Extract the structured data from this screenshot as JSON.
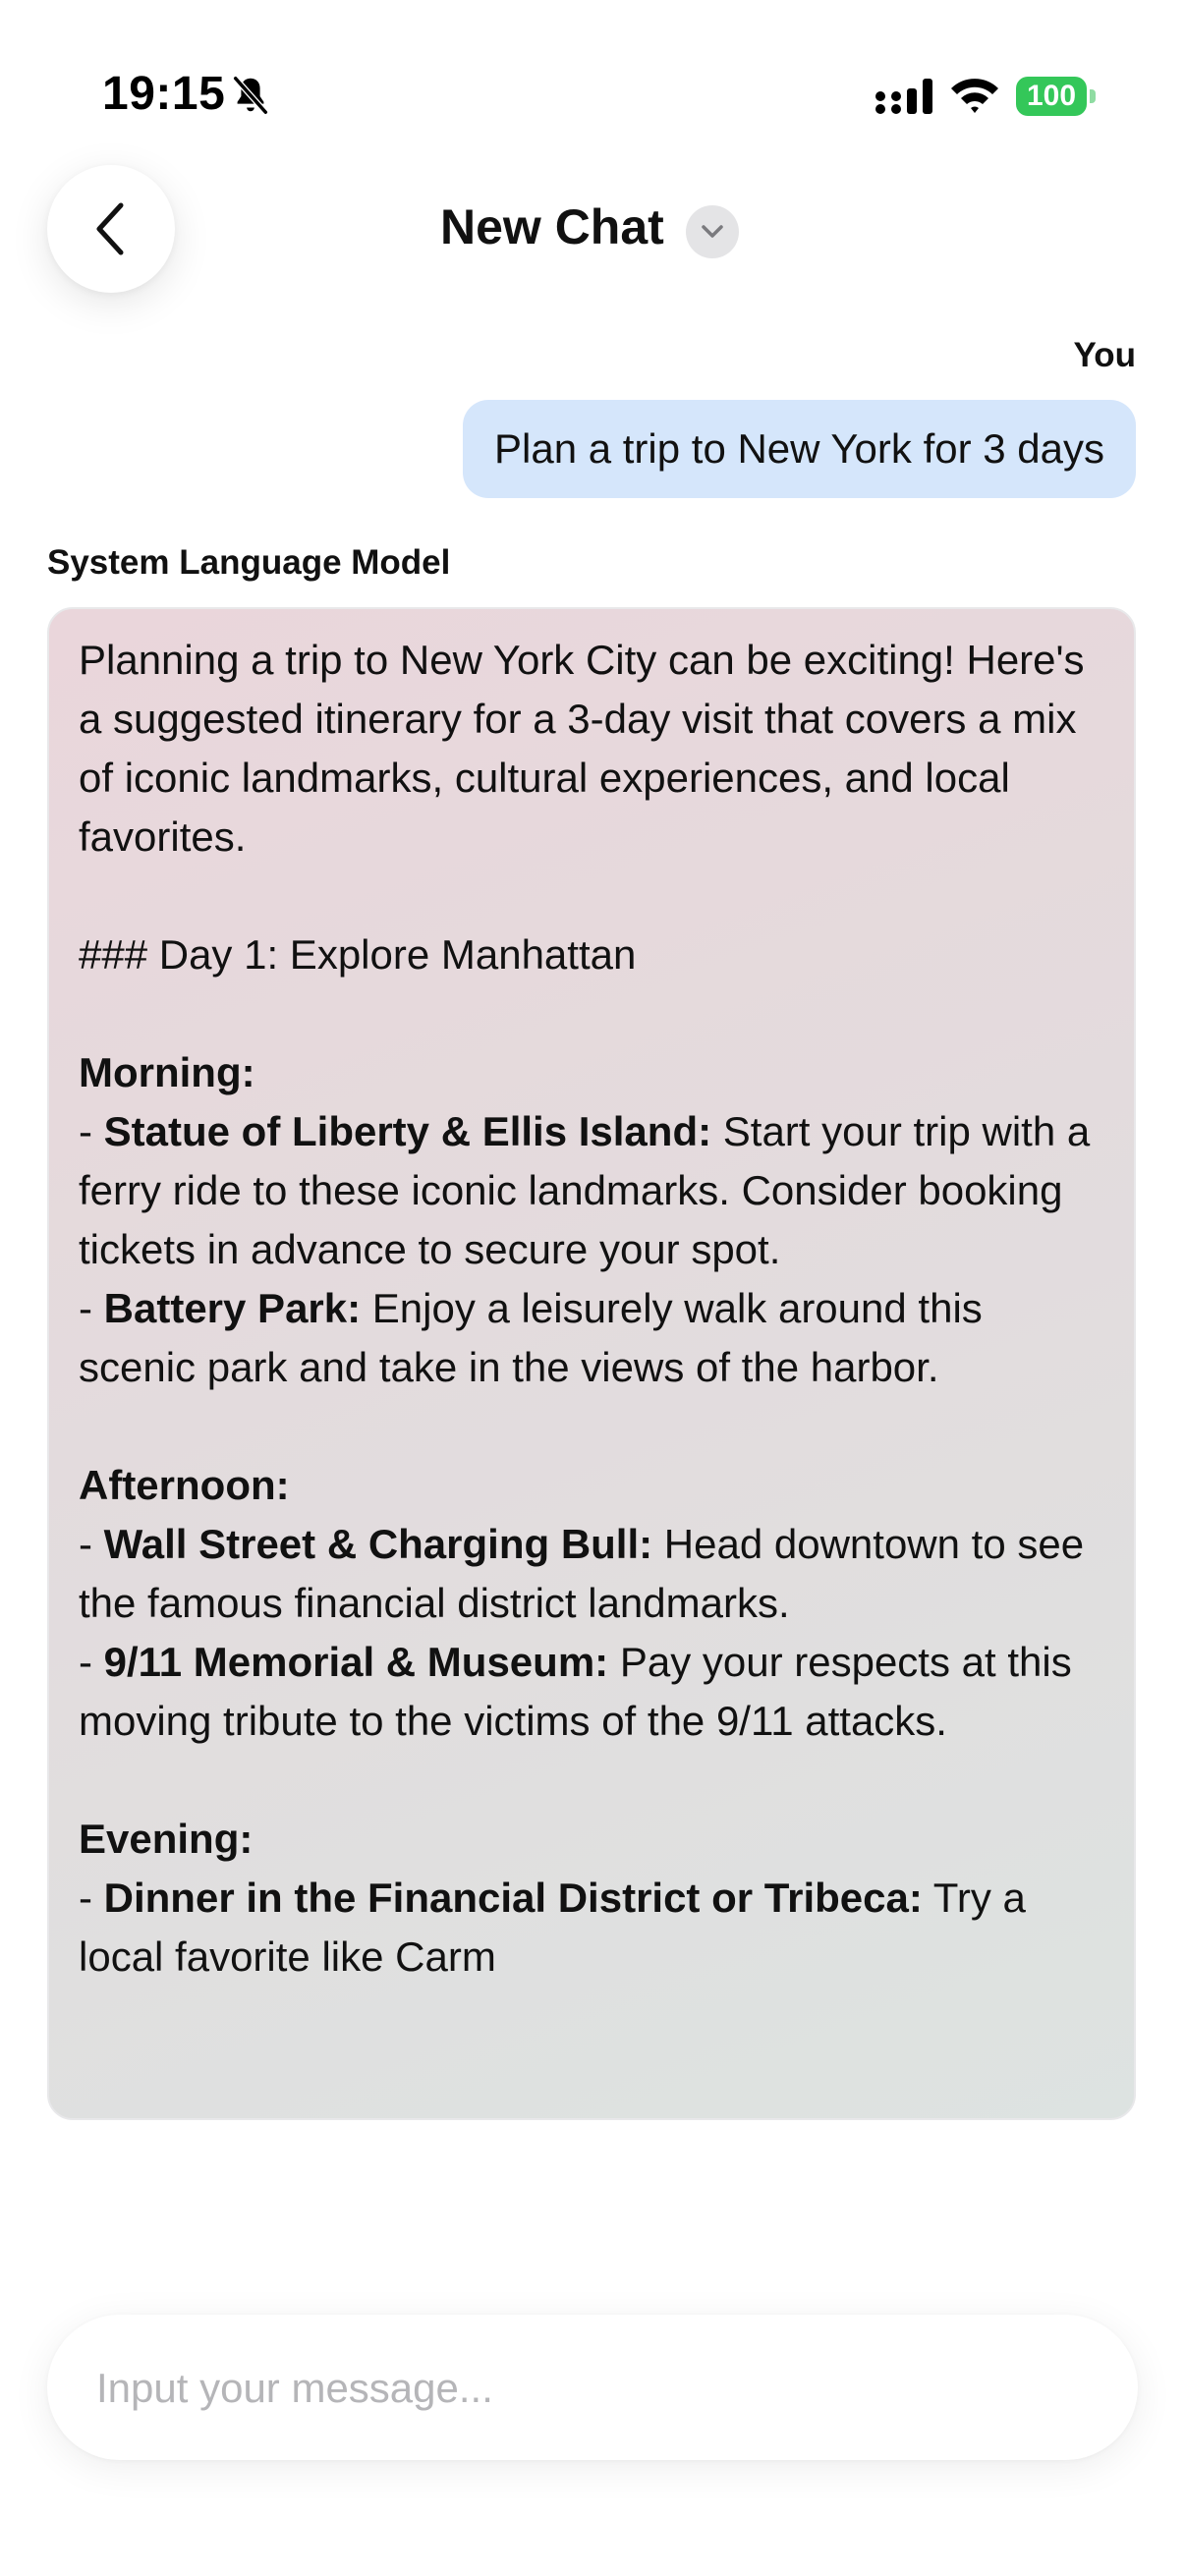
{
  "status_bar": {
    "time": "19:15",
    "battery": "100",
    "icons": [
      "bell-slash-icon",
      "signal-icon",
      "wifi-icon",
      "battery-icon"
    ]
  },
  "header": {
    "title": "New Chat",
    "back_icon": "chevron-left-icon",
    "dropdown_icon": "chevron-down-icon"
  },
  "messages": {
    "user": {
      "sender": "You",
      "text": "Plan a trip to New York for 3 days"
    },
    "model": {
      "sender": "System Language Model",
      "intro": "Planning a trip to New York City can be exciting! Here's a suggested itinerary for a 3-day visit that covers a mix of iconic landmarks, cultural experiences, and local favorites.",
      "day1_heading": "### Day 1: Explore Manhattan",
      "morning": {
        "heading": "Morning:",
        "items": [
          {
            "title": "Statue of Liberty & Ellis Island:",
            "text": " Start your trip with a ferry ride to these iconic landmarks. Consider booking tickets in advance to secure your spot."
          },
          {
            "title": "Battery Park:",
            "text": " Enjoy a leisurely walk around this scenic park and take in the views of the harbor."
          }
        ]
      },
      "afternoon": {
        "heading": "Afternoon:",
        "items": [
          {
            "title": "Wall Street & Charging Bull:",
            "text": " Head downtown to see the famous financial district landmarks."
          },
          {
            "title": "9/11 Memorial & Museum:",
            "text": " Pay your respects at this moving tribute to the victims of the 9/11 attacks."
          }
        ]
      },
      "evening": {
        "heading": "Evening:",
        "items": [
          {
            "title": "Dinner in the Financial District or Tribeca:",
            "text": " Try a local favorite like Carm"
          }
        ]
      }
    }
  },
  "composer": {
    "placeholder": "Input your message..."
  },
  "colors": {
    "user_bubble": "#d5e6fb",
    "model_bubble_start": "#ead6db",
    "model_bubble_end": "#dde3e1",
    "battery": "#34c759"
  }
}
